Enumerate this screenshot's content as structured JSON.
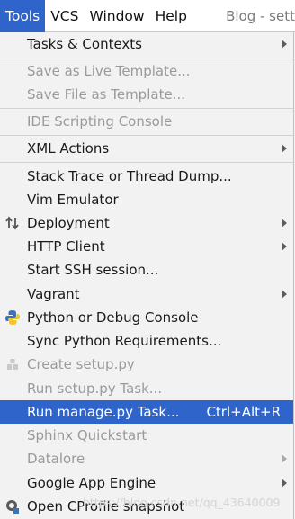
{
  "menubar": {
    "items": [
      {
        "label": "Tools",
        "active": true
      },
      {
        "label": "VCS"
      },
      {
        "label": "Window"
      },
      {
        "label": "Help"
      }
    ],
    "project_title": "Blog - sett"
  },
  "menu": {
    "items": [
      {
        "label": "Tasks & Contexts",
        "submenu": true
      },
      {
        "label": "Save as Live Template...",
        "disabled": true
      },
      {
        "label": "Save File as Template...",
        "disabled": true
      },
      {
        "label": "IDE Scripting Console",
        "disabled": true
      },
      {
        "label": "XML Actions",
        "submenu": true
      },
      {
        "label": "Stack Trace or Thread Dump..."
      },
      {
        "label": "Vim Emulator"
      },
      {
        "label": "Deployment",
        "submenu": true,
        "icon": "deployment-icon"
      },
      {
        "label": "HTTP Client",
        "submenu": true
      },
      {
        "label": "Start SSH session..."
      },
      {
        "label": "Vagrant",
        "submenu": true
      },
      {
        "label": "Python or Debug Console",
        "icon": "python-icon"
      },
      {
        "label": "Sync Python Requirements..."
      },
      {
        "label": "Create setup.py",
        "disabled": true,
        "icon": "package-icon"
      },
      {
        "label": "Run setup.py Task...",
        "disabled": true
      },
      {
        "label": "Run manage.py Task...",
        "shortcut": "Ctrl+Alt+R",
        "selected": true
      },
      {
        "label": "Sphinx Quickstart",
        "disabled": true
      },
      {
        "label": "Datalore",
        "disabled": true,
        "submenu": true
      },
      {
        "label": "Google App Engine",
        "submenu": true
      },
      {
        "label": "Open CProfile snapshot",
        "icon": "profile-snapshot-icon"
      }
    ]
  },
  "watermark": "https://blog.csdn.net/qq_43640009",
  "colors": {
    "selection": "#2f65ca",
    "menu_background": "#f2f2f2",
    "disabled_text": "#9a9a9a"
  }
}
